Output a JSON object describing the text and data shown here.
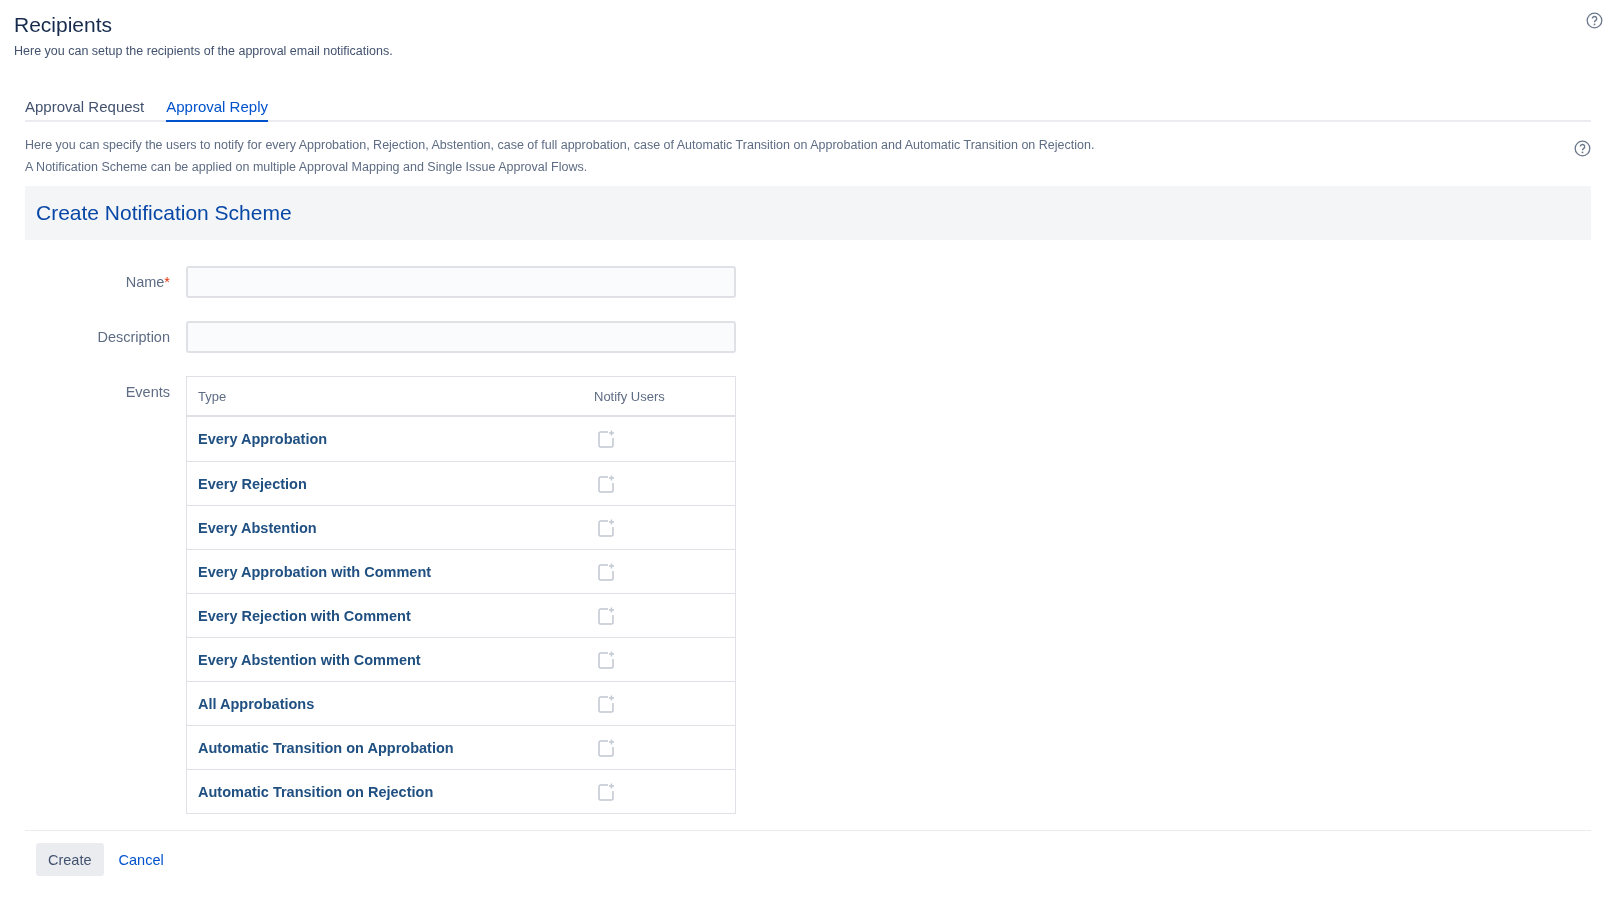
{
  "page": {
    "title": "Recipients",
    "subtitle": "Here you can setup the recipients of the approval email notifications."
  },
  "tabs": [
    {
      "label": "Approval Request",
      "selected": false
    },
    {
      "label": "Approval Reply",
      "selected": true
    }
  ],
  "intro": [
    "Here you can specify the users to notify for every Approbation, Rejection, Abstention, case of full approbation, case of Automatic Transition on Approbation and Automatic Transition on Rejection.",
    "A Notification Scheme can be applied on multiple Approval Mapping and Single Issue Approval Flows."
  ],
  "form": {
    "title": "Create Notification Scheme",
    "name_label": "Name",
    "required_mark": "*",
    "description_label": "Description",
    "events_label": "Events",
    "columns": [
      "Type",
      "Notify Users"
    ],
    "events": [
      {
        "type": "Every Approbation"
      },
      {
        "type": "Every Rejection"
      },
      {
        "type": "Every Abstention"
      },
      {
        "type": "Every Approbation with Comment"
      },
      {
        "type": "Every Rejection with Comment"
      },
      {
        "type": "Every Abstention with Comment"
      },
      {
        "type": "All Approbations"
      },
      {
        "type": "Automatic Transition on Approbation"
      },
      {
        "type": "Automatic Transition on Rejection"
      }
    ]
  },
  "buttons": {
    "create": "Create",
    "cancel": "Cancel"
  }
}
